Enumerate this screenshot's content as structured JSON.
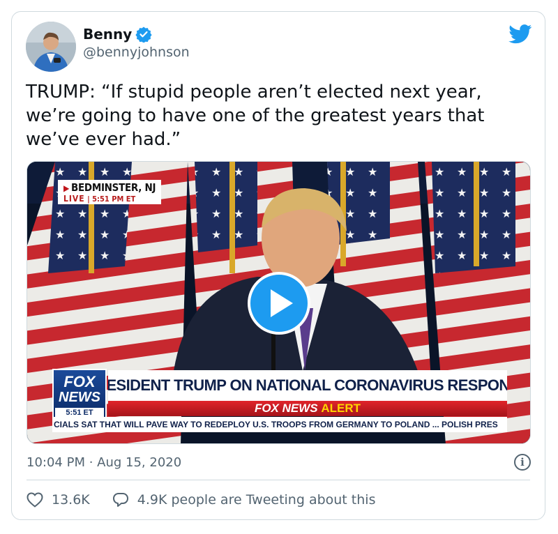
{
  "author": {
    "name": "Benny",
    "handle": "@bennyjohnson",
    "verified": true,
    "avatar_icon": "avatar-photo"
  },
  "brand_icon": "twitter-bird-icon",
  "tweet": {
    "text": "TRUMP: “If stupid people aren’t elected next year, we’re going to have one of the greatest years that we’ve ever had.”"
  },
  "video": {
    "location": "BEDMINSTER, NJ",
    "live_label": "LIVE",
    "live_time": "5:51 PM ET",
    "network_line1": "FOX",
    "network_line2": "NEWS",
    "network_clock": "5:51 ET",
    "headline": "PRESIDENT TRUMP ON NATIONAL CORONAVIRUS RESPONSE",
    "alert_brand": "FOX NEWS",
    "alert_word": "ALERT",
    "ticker": "CIALS SAT THAT WILL PAVE WAY TO REDEPLOY U.S. TROOPS FROM GERMANY TO POLAND ... POLISH PRES",
    "play_icon": "play-icon"
  },
  "meta": {
    "timestamp": "10:04 PM · Aug 15, 2020",
    "info_glyph": "i"
  },
  "actions": {
    "likes": "13.6K",
    "tweeting": "4.9K people are Tweeting about this"
  },
  "colors": {
    "accent": "#1d9bf0",
    "text": "#0f1419",
    "secondary": "#536471",
    "border": "#cfd9de"
  }
}
